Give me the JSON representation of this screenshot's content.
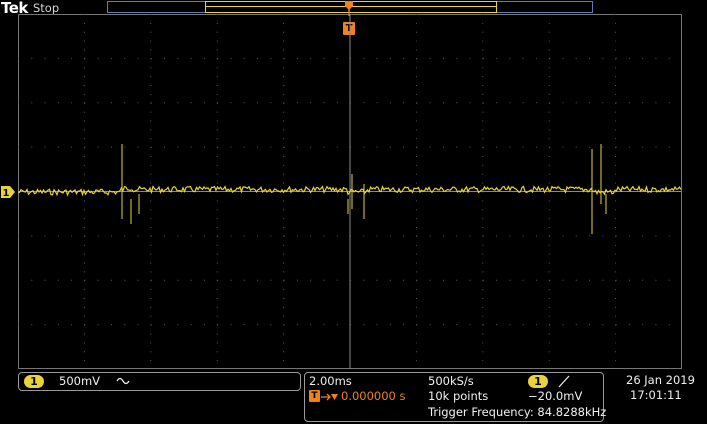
{
  "header": {
    "brand": "Tek",
    "status": "Stop"
  },
  "trigger_marker": {
    "label": "T"
  },
  "channel": {
    "marker_label": "1",
    "color": "#e8d33a"
  },
  "vertical_panel": {
    "channel_label": "1",
    "scale": "500mV",
    "coupling_icon": "ac-wave-icon"
  },
  "horizontal_panel": {
    "time_per_div": "2.00ms",
    "sample_rate": "500kS/s",
    "trigger_channel": "1",
    "slope_icon": "rising-edge-icon",
    "position_prefix": "T",
    "position_value": "0.000000 s",
    "record_length": "10k points",
    "trigger_level": "−20.0mV",
    "trigger_frequency": "Trigger Frequency: 84.8288kHz"
  },
  "datetime": {
    "date": "26 Jan  2019",
    "time": "17:01:11"
  },
  "colors": {
    "trace": "#e8d33a",
    "trigger": "#f0821c",
    "grid": "#5a5a5a",
    "record_bar": "#5f7fae"
  }
}
